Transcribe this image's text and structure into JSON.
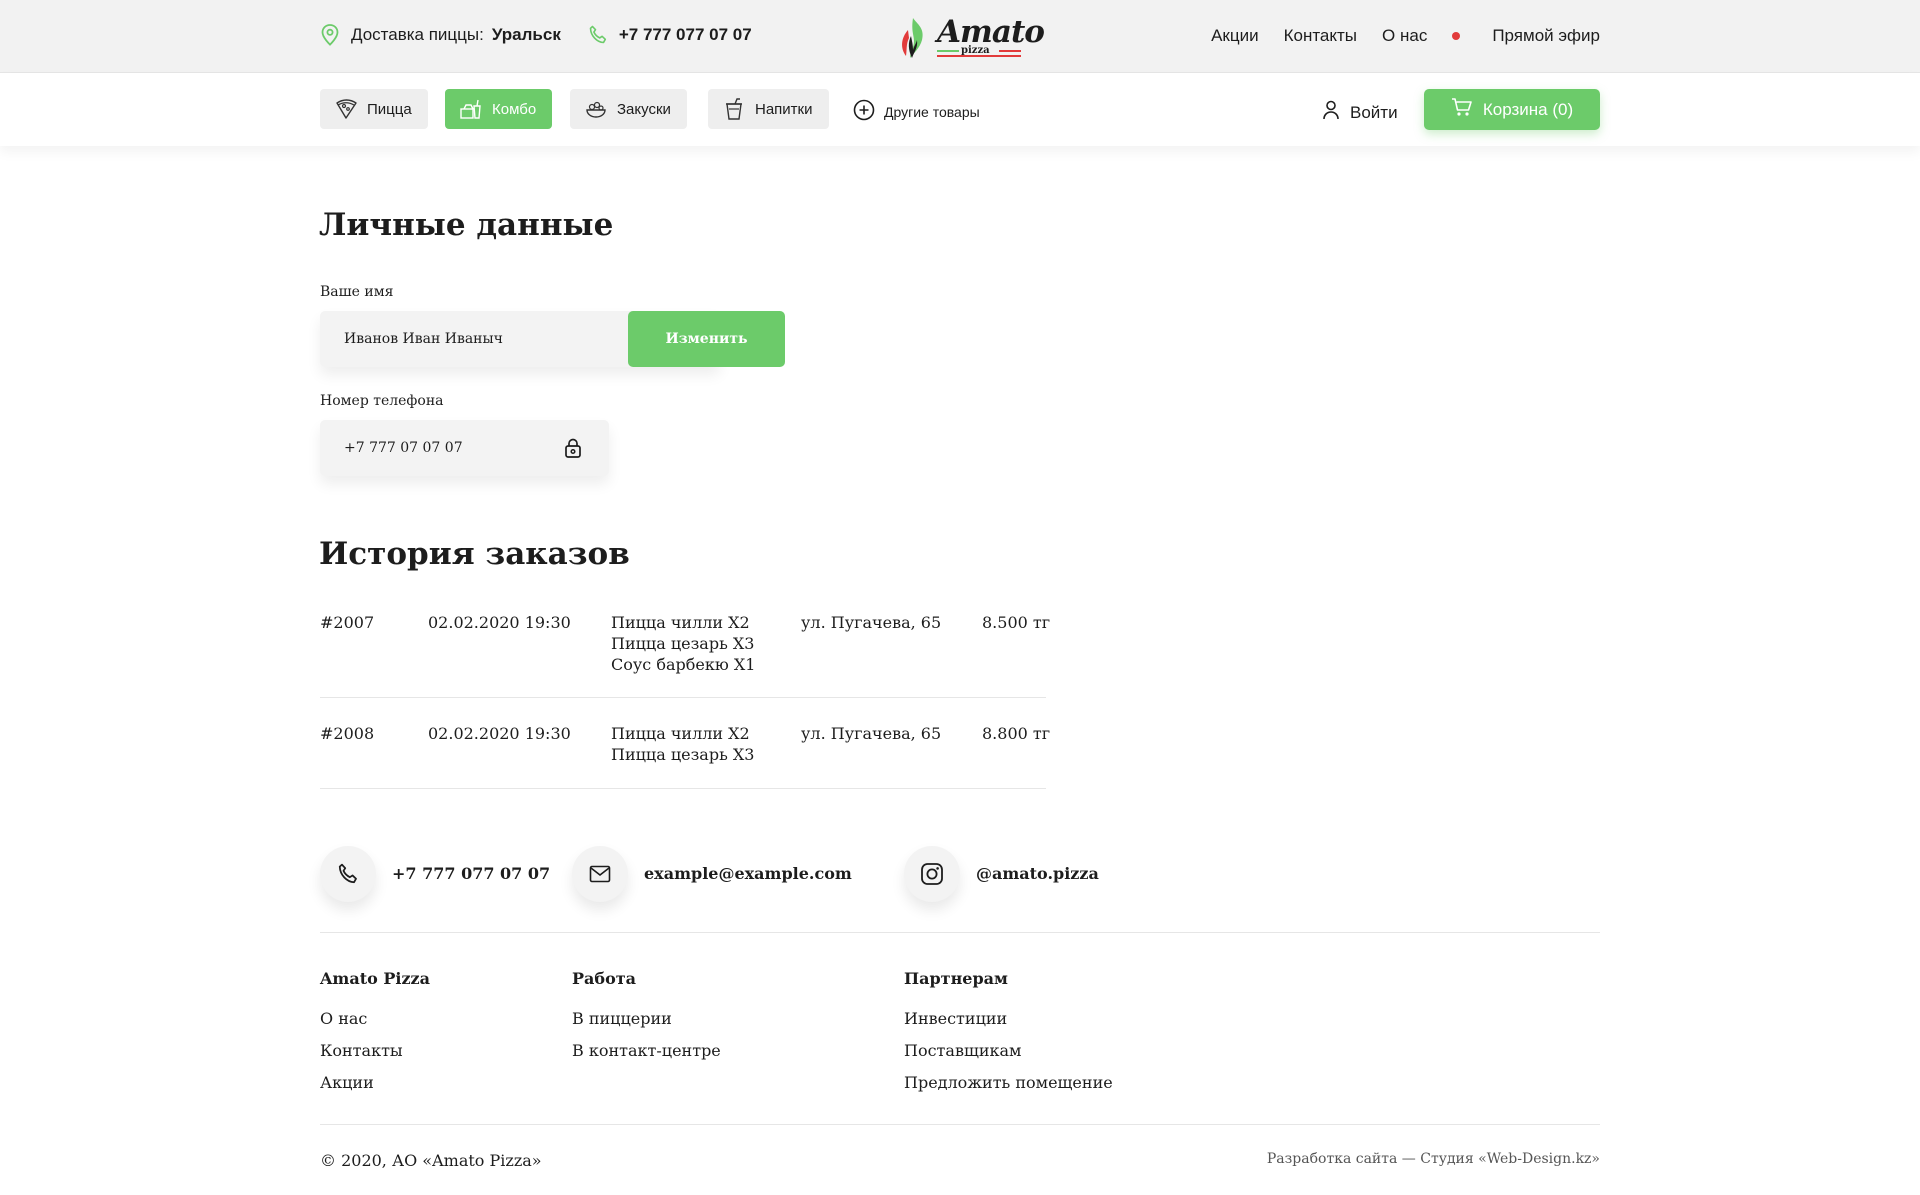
{
  "topbar": {
    "delivery_label": "Доставка пиццы:",
    "city": "Уральск",
    "phone": "+7 777 077 07 07",
    "logo_text": "Amato",
    "logo_sub": "pizza",
    "links": [
      "Акции",
      "Контакты",
      "О нас"
    ],
    "live": "Прямой эфир"
  },
  "nav": {
    "categories": [
      {
        "label": "Пицца",
        "icon": "pizza-icon",
        "active": false
      },
      {
        "label": "Комбо",
        "icon": "combo-icon",
        "active": true
      },
      {
        "label": "Закуски",
        "icon": "snacks-icon",
        "active": false
      },
      {
        "label": "Напитки",
        "icon": "drinks-icon",
        "active": false
      }
    ],
    "other": "Другие товары",
    "login": "Войти",
    "cart": "Корзина (0)"
  },
  "personal": {
    "title": "Личные данные",
    "name_label": "Ваше имя",
    "name_value": "Иванов Иван Иваныч",
    "change_button": "Изменить",
    "phone_label": "Номер телефона",
    "phone_value": "+7 777 07 07 07"
  },
  "orders": {
    "title": "История заказов",
    "rows": [
      {
        "id": "#2007",
        "date": "02.02.2020 19:30",
        "items": [
          "Пицца чилли Х2",
          "Пицца цезарь Х3",
          "Соус барбекю Х1"
        ],
        "address": "ул. Пугачева, 65",
        "sum": "8.500 тг"
      },
      {
        "id": "#2008",
        "date": "02.02.2020 19:30",
        "items": [
          "Пицца чилли Х2",
          "Пицца цезарь Х3"
        ],
        "address": "ул. Пугачева, 65",
        "sum": "8.800 тг"
      }
    ]
  },
  "contacts": {
    "phone": "+7 777 077 07 07",
    "email": "example@example.com",
    "instagram": "@amato.pizza"
  },
  "footer": {
    "columns": [
      {
        "title": "Amato Pizza",
        "links": [
          "О нас",
          "Контакты",
          "Акции"
        ]
      },
      {
        "title": "Работа",
        "links": [
          "В пиццерии",
          "В контакт-центре"
        ]
      },
      {
        "title": "Партнерам",
        "links": [
          "Инвестиции",
          "Поставщикам",
          "Предложить помещение"
        ]
      }
    ],
    "copyright": "© 2020, АО «Amato Pizza»",
    "developer": "Разработка сайта — Студия «Web-Design.kz»"
  },
  "colors": {
    "accent": "#6ccb6a",
    "live_dot": "#e23b3b",
    "text": "#1d1d1d"
  }
}
